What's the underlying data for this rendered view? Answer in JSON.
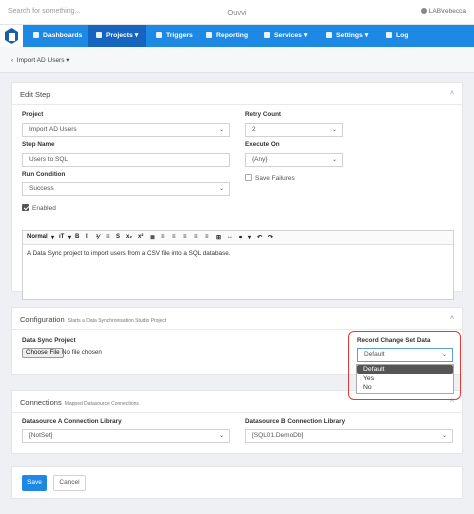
{
  "topbar": {
    "search_placeholder": "Search for something...",
    "brand": "Ouvvi",
    "user": "LAB\\rebecca"
  },
  "nav": {
    "items": [
      {
        "label": "Dashboards"
      },
      {
        "label": "Projects ▾"
      },
      {
        "label": "Triggers"
      },
      {
        "label": "Reporting"
      },
      {
        "label": "Services ▾"
      },
      {
        "label": "Settings ▾"
      },
      {
        "label": "Log"
      }
    ]
  },
  "breadcrumb": {
    "back": "‹",
    "label": "Import AD Users ▾"
  },
  "edit_step": {
    "title": "Edit Step",
    "project_label": "Project",
    "project_value": "Import AD Users",
    "step_name_label": "Step Name",
    "step_name_value": "Users to SQL",
    "run_condition_label": "Run Condition",
    "run_condition_value": "Success",
    "enabled_label": "Enabled",
    "enabled_checked": true,
    "retry_count_label": "Retry Count",
    "retry_count_value": "2",
    "execute_on_label": "Execute On",
    "execute_on_value": "{Any}",
    "save_failures_label": "Save Failures",
    "save_failures_checked": false,
    "editor_toolbar": [
      "Normal",
      "▾",
      "ıT",
      "▾",
      "B",
      "I",
      "⅟",
      "≡",
      "S",
      "x₂",
      "x²",
      "≣",
      "≡",
      "≡",
      "≡",
      "≡",
      "≡",
      "⊞",
      "↔",
      "⚭",
      "▾",
      "↶",
      "↷"
    ],
    "editor_text": "A Data Sync project to import users from a CSV file into a SQL database."
  },
  "configuration": {
    "title": "Configuration",
    "subtitle": "Starts a Data Synchronisation Studio Project",
    "data_sync_label": "Data Sync Project",
    "choose_file": "Choose File",
    "no_file": "No file chosen",
    "record_change_label": "Record Change Set Data",
    "record_change_value": "Default",
    "options": [
      "Default",
      "Yes",
      "No"
    ]
  },
  "connections": {
    "title": "Connections",
    "subtitle": "Mapped Datasource Connections",
    "a_label": "Datasource A Connection Library",
    "a_value": "[NotSet]",
    "b_label": "Datasource B Connection Library",
    "b_value": "[SQL01.DemoDb]"
  },
  "actions": {
    "save": "Save",
    "cancel": "Cancel"
  },
  "colors": {
    "primary": "#1e88e5",
    "nav_active": "#1565c0",
    "highlight_border": "#e53935"
  }
}
